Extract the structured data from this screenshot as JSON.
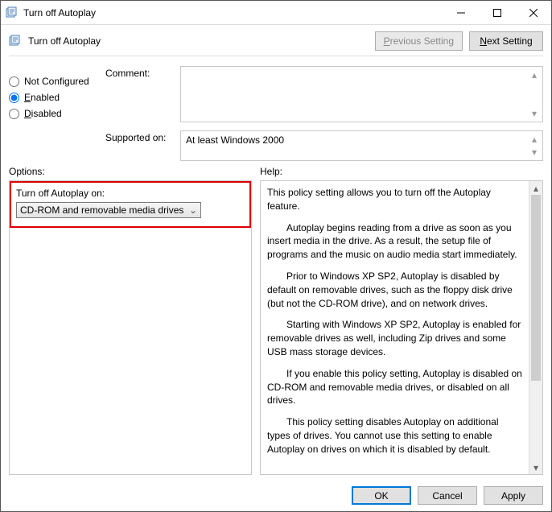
{
  "window": {
    "title": "Turn off Autoplay",
    "subtitle": "Turn off Autoplay"
  },
  "nav": {
    "previous_p": "P",
    "previous_rest": "revious Setting",
    "next_n": "N",
    "next_rest": "ext Setting"
  },
  "state": {
    "not_c": "C",
    "not_rest": "ot Configured",
    "not_label_prefix": "N",
    "enabled_e": "E",
    "enabled_rest": "nabled",
    "disabled_d": "D",
    "disabled_rest": "isabled"
  },
  "labels": {
    "comment_c": "C",
    "comment_rest": "omment:",
    "supported": "Supported on:",
    "options_o": "O",
    "options_rest": "ptions:",
    "help": "Help:"
  },
  "supported_text": "At least Windows 2000",
  "options": {
    "field_label": "Turn off Autoplay on:",
    "selected": "CD-ROM and removable media drives"
  },
  "help_paragraphs": {
    "p1": "This policy setting allows you to turn off the Autoplay feature.",
    "p2": "Autoplay begins reading from a drive as soon as you insert media in the drive. As a result, the setup file of programs and the music on audio media start immediately.",
    "p3": "Prior to Windows XP SP2, Autoplay is disabled by default on removable drives, such as the floppy disk drive (but not the CD-ROM drive), and on network drives.",
    "p4": "Starting with Windows XP SP2, Autoplay is enabled for removable drives as well, including Zip drives and some USB mass storage devices.",
    "p5": "If you enable this policy setting, Autoplay is disabled on CD-ROM and removable media drives, or disabled on all drives.",
    "p6": "This policy setting disables Autoplay on additional types of drives. You cannot use this setting to enable Autoplay on drives on which it is disabled by default."
  },
  "buttons": {
    "ok": "OK",
    "cancel": "Cancel",
    "apply_a": "A",
    "apply_rest": "pply"
  }
}
